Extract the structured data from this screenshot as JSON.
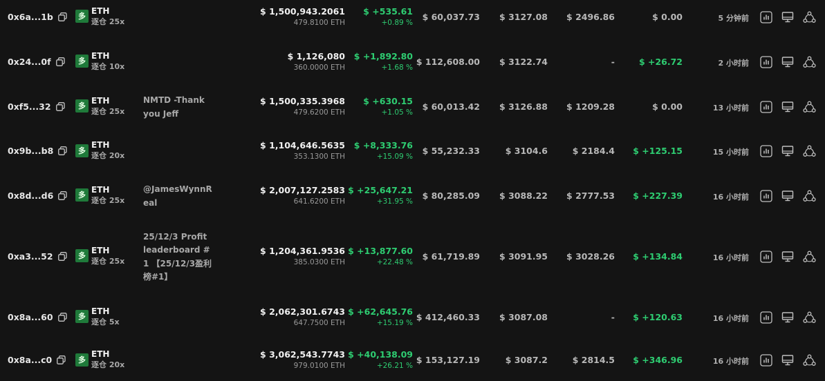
{
  "rows": [
    {
      "address": "0x6a...1b",
      "side_badge": "多",
      "coin": "ETH",
      "leverage": "逐仓 25x",
      "note": "",
      "value": "$ 1,500,943.2061",
      "size": "479.8100 ETH",
      "pnl": "$ +535.61",
      "pnl_pct": "+0.89 %",
      "margin": "$ 60,037.73",
      "entry_price": "$ 3127.08",
      "liq_price": "$ 2496.86",
      "funding": "$ 0.00",
      "funding_positive": false,
      "time": "5 分钟前"
    },
    {
      "address": "0x24...0f",
      "side_badge": "多",
      "coin": "ETH",
      "leverage": "逐仓 10x",
      "note": "",
      "value": "$ 1,126,080",
      "size": "360.0000 ETH",
      "pnl": "$ +1,892.80",
      "pnl_pct": "+1.68 %",
      "margin": "$ 112,608.00",
      "entry_price": "$ 3122.74",
      "liq_price": "-",
      "funding": "$ +26.72",
      "funding_positive": true,
      "time": "2 小时前"
    },
    {
      "address": "0xf5...32",
      "side_badge": "多",
      "coin": "ETH",
      "leverage": "逐仓 25x",
      "note": "NMTD -Thank you Jeff",
      "value": "$ 1,500,335.3968",
      "size": "479.6200 ETH",
      "pnl": "$ +630.15",
      "pnl_pct": "+1.05 %",
      "margin": "$ 60,013.42",
      "entry_price": "$ 3126.88",
      "liq_price": "$ 1209.28",
      "funding": "$ 0.00",
      "funding_positive": false,
      "time": "13 小时前"
    },
    {
      "address": "0x9b...b8",
      "side_badge": "多",
      "coin": "ETH",
      "leverage": "逐仓 20x",
      "note": "",
      "value": "$ 1,104,646.5635",
      "size": "353.1300 ETH",
      "pnl": "$ +8,333.76",
      "pnl_pct": "+15.09 %",
      "margin": "$ 55,232.33",
      "entry_price": "$ 3104.6",
      "liq_price": "$ 2184.4",
      "funding": "$ +125.15",
      "funding_positive": true,
      "time": "15 小时前"
    },
    {
      "address": "0x8d...d6",
      "side_badge": "多",
      "coin": "ETH",
      "leverage": "逐仓 25x",
      "note": "@JamesWynnReal",
      "value": "$ 2,007,127.2583",
      "size": "641.6200 ETH",
      "pnl": "$ +25,647.21",
      "pnl_pct": "+31.95 %",
      "margin": "$ 80,285.09",
      "entry_price": "$ 3088.22",
      "liq_price": "$ 2777.53",
      "funding": "$ +227.39",
      "funding_positive": true,
      "time": "16 小时前"
    },
    {
      "address": "0xa3...52",
      "side_badge": "多",
      "coin": "ETH",
      "leverage": "逐仓 25x",
      "note": "25/12/3 Profit leaderboard #1 【25/12/3盈利榜#1】",
      "value": "$ 1,204,361.9536",
      "size": "385.0300 ETH",
      "pnl": "$ +13,877.60",
      "pnl_pct": "+22.48 %",
      "margin": "$ 61,719.89",
      "entry_price": "$ 3091.95",
      "liq_price": "$ 3028.26",
      "funding": "$ +134.84",
      "funding_positive": true,
      "time": "16 小时前"
    },
    {
      "address": "0x8a...60",
      "side_badge": "多",
      "coin": "ETH",
      "leverage": "逐仓 5x",
      "note": "",
      "value": "$ 2,062,301.6743",
      "size": "647.7500 ETH",
      "pnl": "$ +62,645.76",
      "pnl_pct": "+15.19 %",
      "margin": "$ 412,460.33",
      "entry_price": "$ 3087.08",
      "liq_price": "-",
      "funding": "$ +120.63",
      "funding_positive": true,
      "time": "16 小时前"
    },
    {
      "address": "0x8a...c0",
      "side_badge": "多",
      "coin": "ETH",
      "leverage": "逐仓 20x",
      "note": "",
      "value": "$ 3,062,543.7743",
      "size": "979.0100 ETH",
      "pnl": "$ +40,138.09",
      "pnl_pct": "+26.21 %",
      "margin": "$ 153,127.19",
      "entry_price": "$ 3087.2",
      "liq_price": "$ 2814.5",
      "funding": "$ +346.96",
      "funding_positive": true,
      "time": "16 小时前"
    }
  ],
  "icons": {
    "copy": "copy-icon",
    "chart": "bar-chart-icon",
    "monitor": "monitor-icon",
    "share": "share-icon"
  },
  "colors": {
    "background": "#141414",
    "profit_green": "#2ecc71",
    "long_badge": "#1f7a3a"
  }
}
